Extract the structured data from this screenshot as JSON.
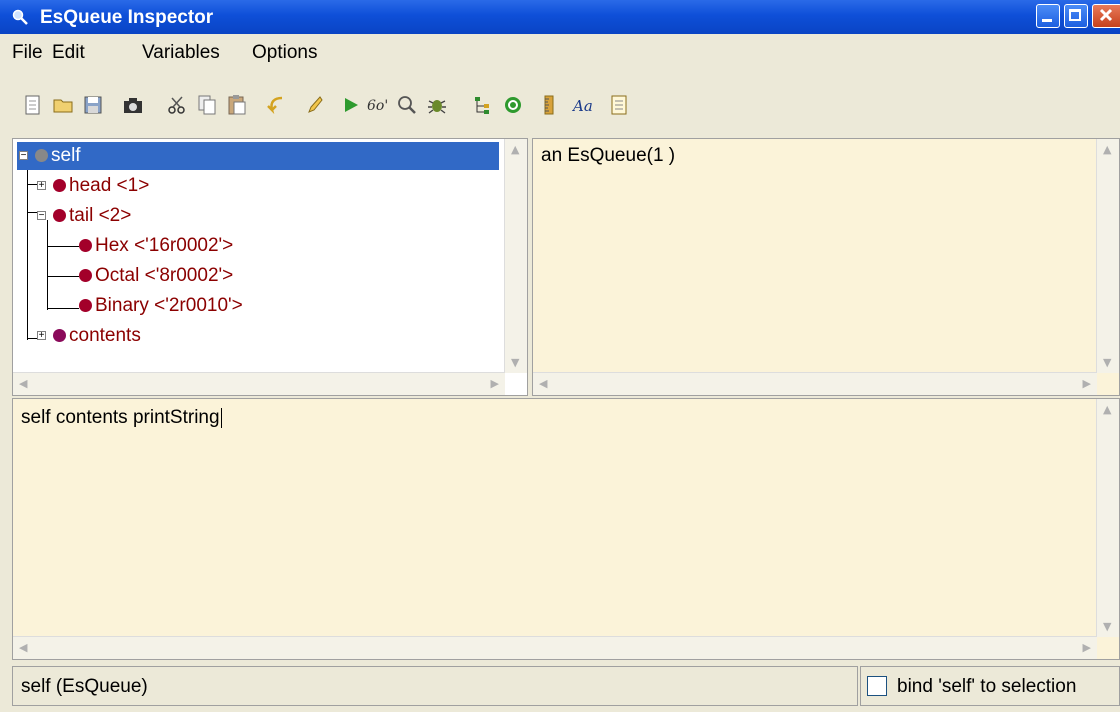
{
  "window": {
    "title": "EsQueue Inspector"
  },
  "menu": [
    "File",
    "Edit",
    "Variables",
    "Options"
  ],
  "toolbar": {
    "icons": [
      "new-file-icon",
      "open-folder-icon",
      "save-icon",
      "camera-icon",
      "cut-icon",
      "copy-icon",
      "paste-icon",
      "undo-icon",
      "brush-icon",
      "run-icon",
      "inspect-icon",
      "find-icon",
      "debug-icon",
      "tree-icon",
      "refresh-icon",
      "ruler-icon",
      "font-icon",
      "document-icon"
    ]
  },
  "tree": {
    "items": [
      {
        "label": "self"
      },
      {
        "label": "head <1>"
      },
      {
        "label": "tail <2>"
      },
      {
        "label": "Hex <'16r0002'>"
      },
      {
        "label": "Octal <'8r0002'>"
      },
      {
        "label": "Binary <'2r0010'>"
      },
      {
        "label": "contents"
      }
    ]
  },
  "value_panel": {
    "text": "an EsQueue(1 )"
  },
  "code_panel": {
    "text": "self contents printString"
  },
  "status": {
    "left_text": "self (EsQueue)",
    "checkbox_label": "bind 'self' to selection"
  }
}
